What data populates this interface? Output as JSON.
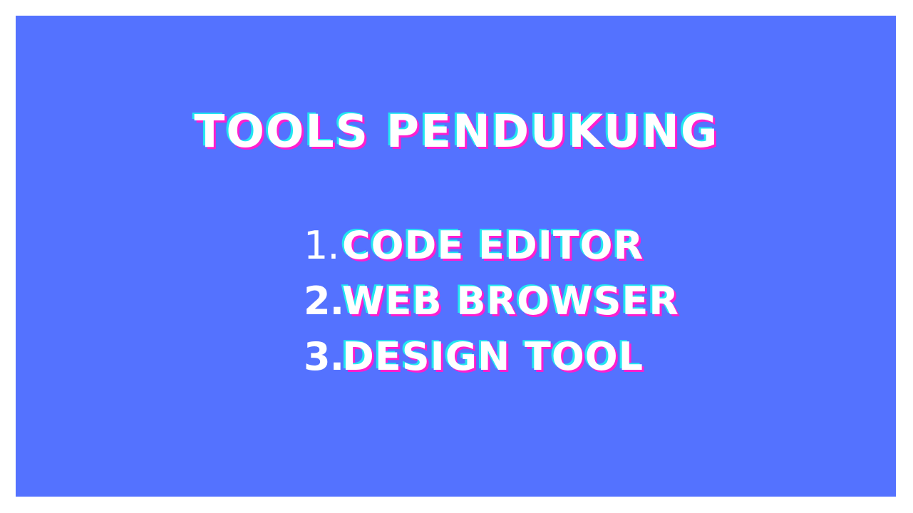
{
  "slide": {
    "background_color": "#5472ff",
    "title": "TOOLS PENDUKUNG",
    "items": [
      {
        "number": "1.",
        "label": "CODE EDITOR"
      },
      {
        "number": "2.",
        "label": "WEB BROWSER"
      },
      {
        "number": "3.",
        "label": "DESIGN TOOL"
      }
    ],
    "accent_colors": {
      "text": "#ffffff",
      "glitch_cyan": "#22e6f0",
      "glitch_magenta": "#ff1ecf"
    }
  }
}
